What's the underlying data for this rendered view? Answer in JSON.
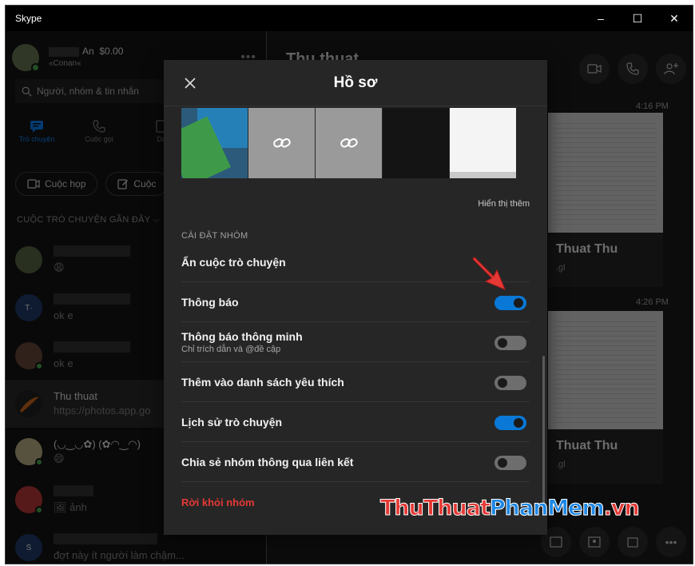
{
  "window": {
    "title": "Skype",
    "controls": [
      "–",
      "☐",
      "✕"
    ]
  },
  "profile": {
    "name": "An",
    "balance": "$0.00",
    "status": "«Conan«"
  },
  "search": {
    "placeholder": "Người, nhóm & tin nhắn"
  },
  "nav": {
    "chats": "Trò chuyện",
    "calls": "Cuộc gọi",
    "contacts": "Da"
  },
  "actions": {
    "meeting": "Cuộc họp",
    "new_chat": "Cuộc"
  },
  "recent_label": "CUỘC TRÒ CHUYỆN GẦN ĐÂY",
  "conversations": [
    {
      "name": "",
      "preview": "😩",
      "avatar_color": "#5c6b45",
      "initial": "",
      "online": false
    },
    {
      "name": "",
      "preview": "ok e",
      "avatar_color": "#1f3c6e",
      "initial": "T·",
      "online": false
    },
    {
      "name": "",
      "preview": "ok e",
      "avatar_color": "#6a4a3a",
      "initial": "",
      "online": true
    },
    {
      "name": "Thu thuat",
      "preview": "https://photos.app.go",
      "avatar_color": "#222",
      "initial": "",
      "online": false
    },
    {
      "name": "(◡‿◡✿) (✿◠‿◠)",
      "preview": "😄",
      "avatar_color": "#c2b68a",
      "initial": "",
      "online": true
    },
    {
      "name": "",
      "preview": "🖼 ảnh",
      "avatar_color": "#c23a3a",
      "initial": "",
      "online": true
    },
    {
      "name": "",
      "preview": "đợt này ít người làm chậm...",
      "avatar_color": "#1f3c6e",
      "initial": "S",
      "online": false
    }
  ],
  "chat": {
    "title": "Thu thuat",
    "cards": [
      {
        "title": "Thuat Thu",
        "sub": ".gl",
        "time": "4:16 PM"
      },
      {
        "title": "Thuat Thu",
        "sub": ".gl",
        "time": "4:26 PM"
      }
    ]
  },
  "modal": {
    "title": "Hồ sơ",
    "show_more": "Hiển thị thêm",
    "settings_heading": "CÀI ĐẶT NHÓM",
    "settings": [
      {
        "label": "Ẩn cuộc trò chuyện",
        "sub": "",
        "toggle": null
      },
      {
        "label": "Thông báo",
        "sub": "",
        "toggle": true
      },
      {
        "label": "Thông báo thông minh",
        "sub": "Chỉ trích dẫn và @đề cập",
        "toggle": false
      },
      {
        "label": "Thêm vào danh sách yêu thích",
        "sub": "",
        "toggle": false
      },
      {
        "label": "Lịch sử trò chuyện",
        "sub": "",
        "toggle": true
      },
      {
        "label": "Chia sẻ nhóm thông qua liên kết",
        "sub": "",
        "toggle": false
      }
    ],
    "leave_label": "Rời khỏi nhóm"
  },
  "watermark": {
    "part1": "ThuThuat",
    "part2": "PhanMem",
    "part3": ".vn"
  },
  "colors": {
    "accent": "#0a78d7",
    "danger": "#e53935",
    "arrow": "#e53935"
  }
}
